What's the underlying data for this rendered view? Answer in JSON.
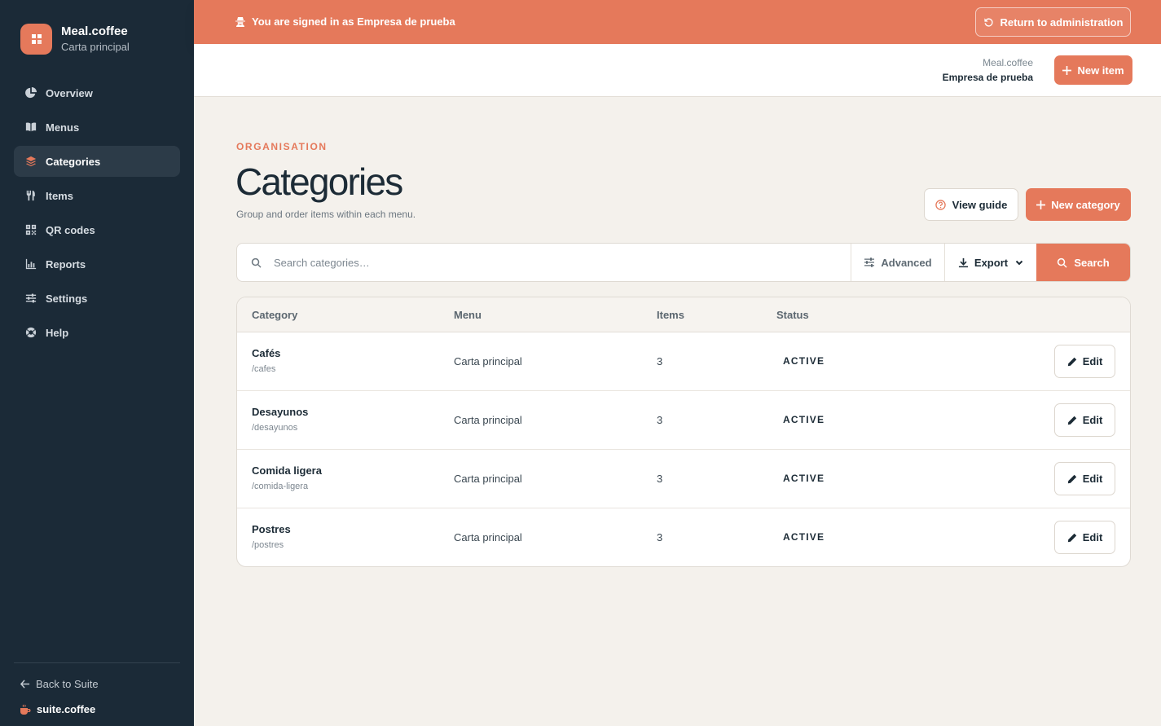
{
  "brand": {
    "name": "Meal.coffee",
    "subtitle": "Carta principal"
  },
  "nav": {
    "items": [
      {
        "label": "Overview",
        "icon": "chart-pie-icon"
      },
      {
        "label": "Menus",
        "icon": "book-icon"
      },
      {
        "label": "Categories",
        "icon": "layers-icon",
        "active": true
      },
      {
        "label": "Items",
        "icon": "utensils-icon"
      },
      {
        "label": "QR codes",
        "icon": "qr-code-icon"
      },
      {
        "label": "Reports",
        "icon": "bar-chart-icon"
      },
      {
        "label": "Settings",
        "icon": "sliders-icon"
      },
      {
        "label": "Help",
        "icon": "life-ring-icon"
      }
    ]
  },
  "footer": {
    "back_label": "Back to Suite",
    "suite_label": "suite.coffee"
  },
  "banner": {
    "text": "You are signed in as Empresa de prueba",
    "return_label": "Return to administration"
  },
  "header": {
    "app_name": "Meal.coffee",
    "company": "Empresa de prueba",
    "new_item_label": "New item"
  },
  "page": {
    "eyebrow": "ORGANISATION",
    "title": "Categories",
    "subtitle": "Group and order items within each menu.",
    "guide_label": "View guide",
    "new_category_label": "New category"
  },
  "search": {
    "placeholder": "Search categories…",
    "advanced_label": "Advanced",
    "export_label": "Export",
    "search_label": "Search"
  },
  "table": {
    "columns": {
      "category": "Category",
      "menu": "Menu",
      "items": "Items",
      "status": "Status"
    },
    "edit_label": "Edit",
    "rows": [
      {
        "name": "Cafés",
        "slug": "/cafes",
        "menu": "Carta principal",
        "items": "3",
        "status": "ACTIVE"
      },
      {
        "name": "Desayunos",
        "slug": "/desayunos",
        "menu": "Carta principal",
        "items": "3",
        "status": "ACTIVE"
      },
      {
        "name": "Comida ligera",
        "slug": "/comida-ligera",
        "menu": "Carta principal",
        "items": "3",
        "status": "ACTIVE"
      },
      {
        "name": "Postres",
        "slug": "/postres",
        "menu": "Carta principal",
        "items": "3",
        "status": "ACTIVE"
      }
    ]
  },
  "colors": {
    "accent": "#e5795b",
    "sidebar": "#1b2a37",
    "background": "#f4f1ec"
  }
}
